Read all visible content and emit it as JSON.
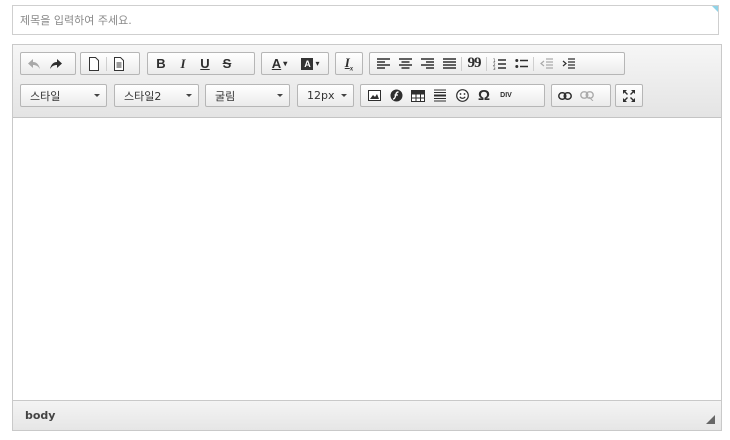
{
  "title_field": {
    "placeholder": "제목을 입력하여 주세요.",
    "value": ""
  },
  "toolbar": {
    "row1": [
      [
        "undo-icon",
        "redo-icon"
      ],
      [
        "new-page-icon",
        "preview-icon"
      ],
      [
        "bold-icon",
        "italic-icon",
        "underline-icon",
        "strikethrough-icon"
      ],
      [
        "text-color-icon",
        "background-color-icon"
      ],
      [
        "remove-format-icon"
      ],
      [
        "align-left-icon",
        "align-center-icon",
        "align-right-icon",
        "align-justify-icon",
        "blockquote-icon",
        "numbered-list-icon",
        "bulleted-list-icon",
        "outdent-icon",
        "indent-icon"
      ]
    ],
    "row2_dropdowns": {
      "style1": "스타일",
      "style2": "스타일2",
      "font": "굴림",
      "size": "12px"
    },
    "bold_glyph": "B",
    "italic_glyph": "I",
    "underline_glyph": "U",
    "strike_glyph": "S",
    "text_color_glyph": "A",
    "bg_color_glyph": "A",
    "remove_format_glyph": "I",
    "remove_format_sub": "x",
    "blockquote_glyph": "99",
    "omega_glyph": "Ω",
    "div_glyph": "DIV"
  },
  "status_bar": {
    "path": "body"
  },
  "colors": {
    "accent": "#8fd3e8",
    "border": "#c9c9c9",
    "toolbar_top": "#f6f6f6",
    "toolbar_bottom": "#e4e4e4"
  }
}
